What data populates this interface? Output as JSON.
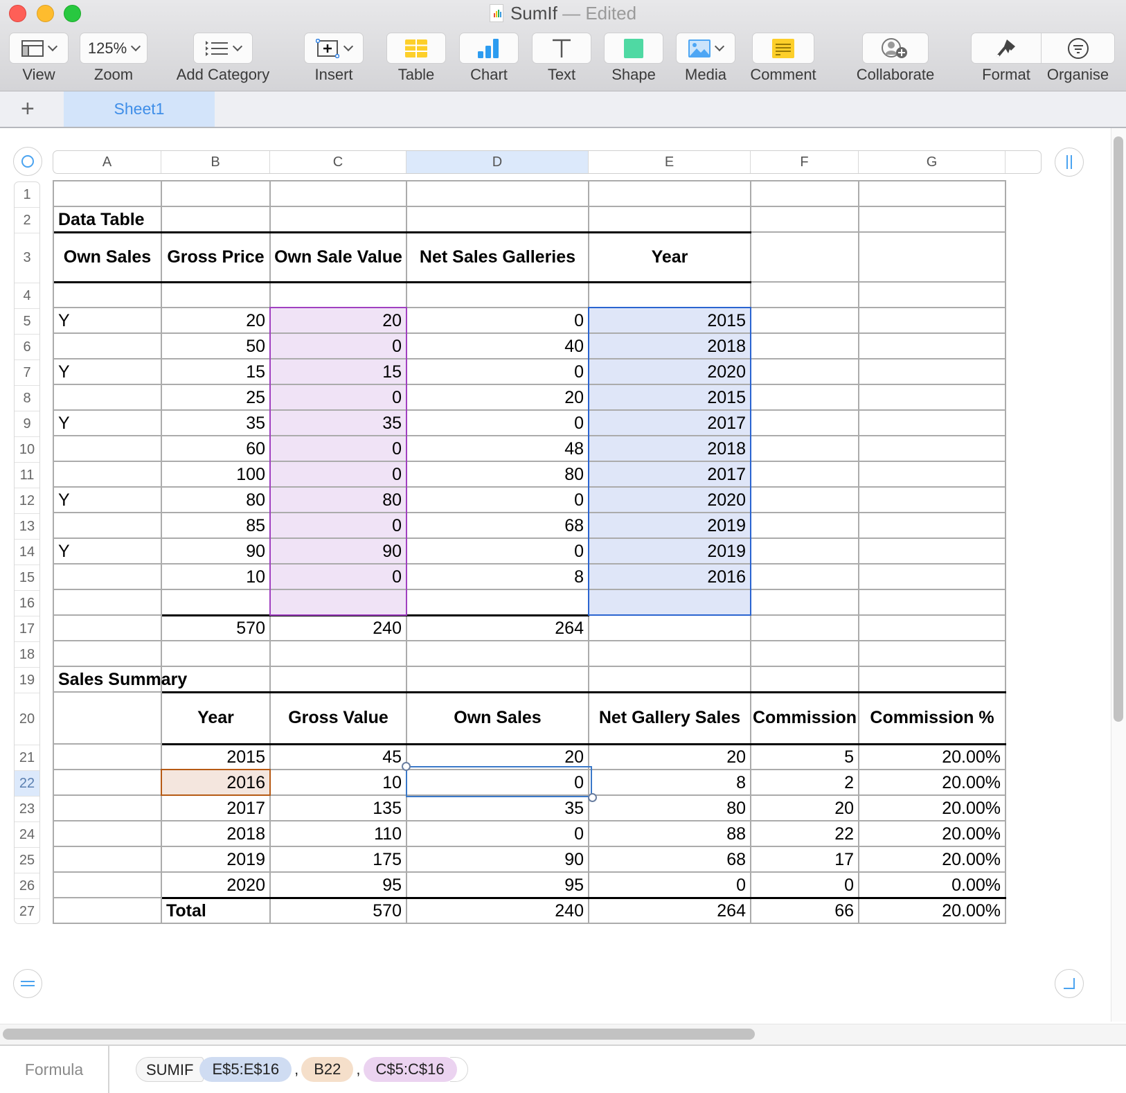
{
  "window": {
    "title": "SumIf",
    "separator": "—",
    "status": "Edited"
  },
  "toolbar": {
    "items": [
      {
        "id": "view",
        "label": "View",
        "icon": "sidebar-view-icon",
        "dropdown": true
      },
      {
        "id": "zoom",
        "label": "Zoom",
        "value": "125%",
        "dropdown": true
      },
      {
        "id": "add-category",
        "label": "Add Category",
        "icon": "list-category-icon",
        "dropdown": true
      },
      {
        "id": "insert",
        "label": "Insert",
        "icon": "insert-plus-icon",
        "dropdown": true
      },
      {
        "id": "table",
        "label": "Table",
        "icon": "table-icon"
      },
      {
        "id": "chart",
        "label": "Chart",
        "icon": "bar-chart-icon"
      },
      {
        "id": "text",
        "label": "Text",
        "icon": "text-t-icon"
      },
      {
        "id": "shape",
        "label": "Shape",
        "icon": "square-shape-icon"
      },
      {
        "id": "media",
        "label": "Media",
        "icon": "image-icon",
        "dropdown": true
      },
      {
        "id": "comment",
        "label": "Comment",
        "icon": "comment-note-icon"
      },
      {
        "id": "collaborate",
        "label": "Collaborate",
        "icon": "add-person-icon"
      },
      {
        "id": "format",
        "label": "Format",
        "icon": "paintbrush-icon"
      },
      {
        "id": "organise",
        "label": "Organise",
        "icon": "filter-circle-icon"
      }
    ]
  },
  "tabs": {
    "add_label": "+",
    "sheets": [
      {
        "label": "Sheet1",
        "active": true
      }
    ]
  },
  "columns": [
    "A",
    "B",
    "C",
    "D",
    "E",
    "F",
    "G"
  ],
  "selected_column": "D",
  "rows": [
    "1",
    "2",
    "3",
    "4",
    "5",
    "6",
    "7",
    "8",
    "9",
    "10",
    "11",
    "12",
    "13",
    "14",
    "15",
    "16",
    "17",
    "18",
    "19",
    "20",
    "21",
    "22",
    "23",
    "24",
    "25",
    "26",
    "27"
  ],
  "selected_row": "22",
  "data_table": {
    "title": "Data Table",
    "headers": [
      "Own Sales",
      "Gross Price",
      "Own Sale Value",
      "Net Sales Galleries",
      "Year"
    ],
    "rows": [
      [
        "Y",
        "20",
        "20",
        "0",
        "2015"
      ],
      [
        "",
        "50",
        "0",
        "40",
        "2018"
      ],
      [
        "Y",
        "15",
        "15",
        "0",
        "2020"
      ],
      [
        "",
        "25",
        "0",
        "20",
        "2015"
      ],
      [
        "Y",
        "35",
        "35",
        "0",
        "2017"
      ],
      [
        "",
        "60",
        "0",
        "48",
        "2018"
      ],
      [
        "",
        "100",
        "0",
        "80",
        "2017"
      ],
      [
        "Y",
        "80",
        "80",
        "0",
        "2020"
      ],
      [
        "",
        "85",
        "0",
        "68",
        "2019"
      ],
      [
        "Y",
        "90",
        "90",
        "0",
        "2019"
      ],
      [
        "",
        "10",
        "0",
        "8",
        "2016"
      ]
    ],
    "totals": [
      "",
      "570",
      "240",
      "264",
      ""
    ]
  },
  "sales_summary": {
    "title": "Sales Summary",
    "headers": [
      "",
      "Year",
      "Gross Value",
      "Own Sales",
      "Net Gallery Sales",
      "Commission",
      "Commission %"
    ],
    "rows": [
      [
        "",
        "2015",
        "45",
        "20",
        "20",
        "5",
        "20.00%"
      ],
      [
        "",
        "2016",
        "10",
        "0",
        "8",
        "2",
        "20.00%"
      ],
      [
        "",
        "2017",
        "135",
        "35",
        "80",
        "20",
        "20.00%"
      ],
      [
        "",
        "2018",
        "110",
        "0",
        "88",
        "22",
        "20.00%"
      ],
      [
        "",
        "2019",
        "175",
        "90",
        "68",
        "17",
        "20.00%"
      ],
      [
        "",
        "2020",
        "95",
        "95",
        "0",
        "0",
        "0.00%"
      ]
    ],
    "total": [
      "",
      "Total",
      "570",
      "240",
      "264",
      "66",
      "20.00%"
    ]
  },
  "formula_bar": {
    "label": "Formula",
    "function": "SUMIF",
    "args": [
      "E$5:E$16",
      "B22",
      "C$5:C$16"
    ],
    "separator": ","
  },
  "colors": {
    "accent": "#3f8ee8",
    "range_purple": "#a040c0",
    "range_blue": "#2a64d0",
    "ref_orange": "#b65a14"
  }
}
